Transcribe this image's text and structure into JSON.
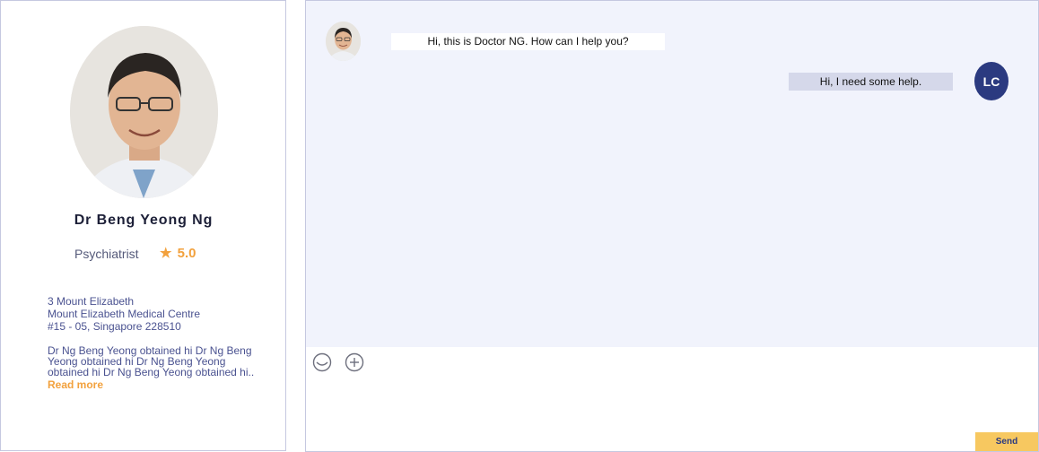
{
  "profile": {
    "name": "Dr Beng Yeong Ng",
    "specialty": "Psychiatrist",
    "rating": "5.0",
    "star_icon": "★",
    "address_lines": [
      "3 Mount Elizabeth",
      "Mount Elizabeth Medical Centre",
      "#15 - 05, Singapore 228510"
    ],
    "bio_lines": [
      "Dr Ng Beng Yeong obtained hi Dr Ng Beng",
      "Yeong obtained hi Dr Ng Beng Yeong",
      "obtained hi Dr Ng Beng Yeong obtained hi.."
    ],
    "read_more_label": "Read more"
  },
  "chat": {
    "messages": [
      {
        "sender": "doctor",
        "text": "Hi, this is Doctor NG. How can I help you?"
      },
      {
        "sender": "user",
        "text": "Hi, I need some help."
      }
    ],
    "user_initials": "LC",
    "composer": {
      "emoji_icon": "emoji-icon",
      "add_icon": "plus-circle-icon",
      "input_placeholder": "",
      "send_label": "Send"
    }
  },
  "colors": {
    "accent_orange": "#f2a13d",
    "navy": "#2b3a80",
    "chat_bg": "#f1f3fc",
    "user_bubble": "#d5d8ea",
    "send_button": "#f7c860"
  }
}
